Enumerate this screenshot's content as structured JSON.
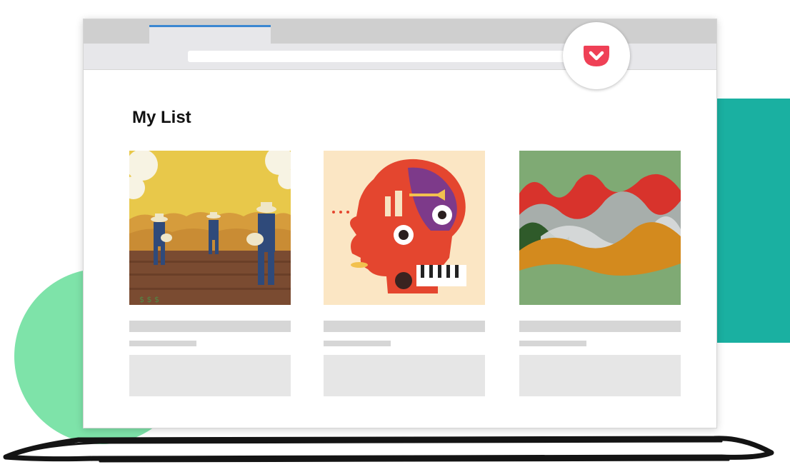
{
  "page": {
    "title": "My List"
  },
  "colors": {
    "accent_tab": "#3b87d1",
    "pocket_brand": "#ef4056",
    "deco_green": "#7ee3a9",
    "deco_teal": "#1ab0a1",
    "placeholder_dark": "#d6d6d6",
    "placeholder_light": "#e6e6e6"
  },
  "toolbar": {
    "pocket_icon": "pocket-icon",
    "address_value": ""
  },
  "cards": [
    {
      "illustration": "farmers-sowing-dollar-seeds",
      "title": "",
      "meta": "",
      "excerpt": ""
    },
    {
      "illustration": "music-themed-head",
      "title": "",
      "meta": "",
      "excerpt": ""
    },
    {
      "illustration": "abstract-wave-layers",
      "title": "",
      "meta": "",
      "excerpt": ""
    }
  ]
}
